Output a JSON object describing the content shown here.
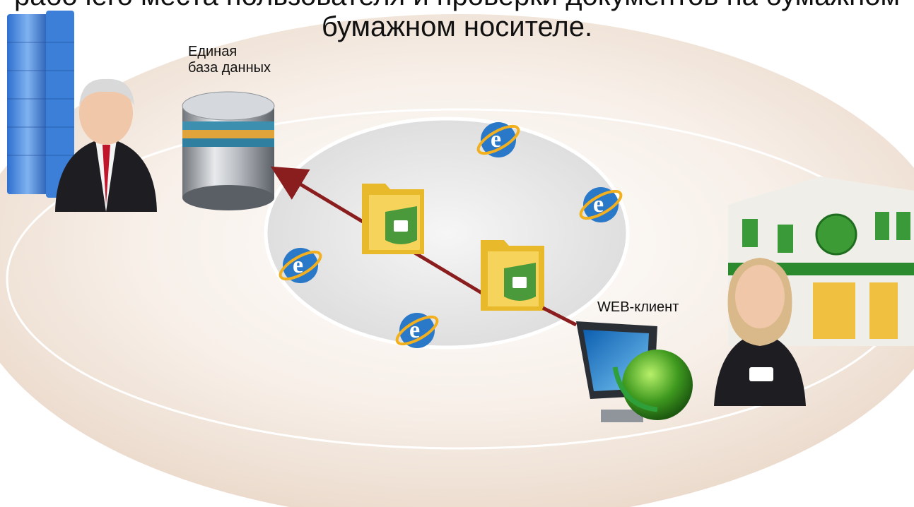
{
  "header": {
    "line1": "рабочего места пользователя и проверки документов на бумажном",
    "line2": "бумажном носителе."
  },
  "labels": {
    "database": [
      "Единая",
      "база данных"
    ],
    "web_client": "WEB-клиент"
  },
  "colors": {
    "background_ring": "#f2e6dc",
    "inner_ellipse": "#e9e9ea",
    "arrow": "#8a1d1d",
    "folder": "#f1c93c",
    "lock_shield": "#4a9a3c",
    "ie_icon": "#2a78c8",
    "db_bands": "#e3a63a"
  }
}
